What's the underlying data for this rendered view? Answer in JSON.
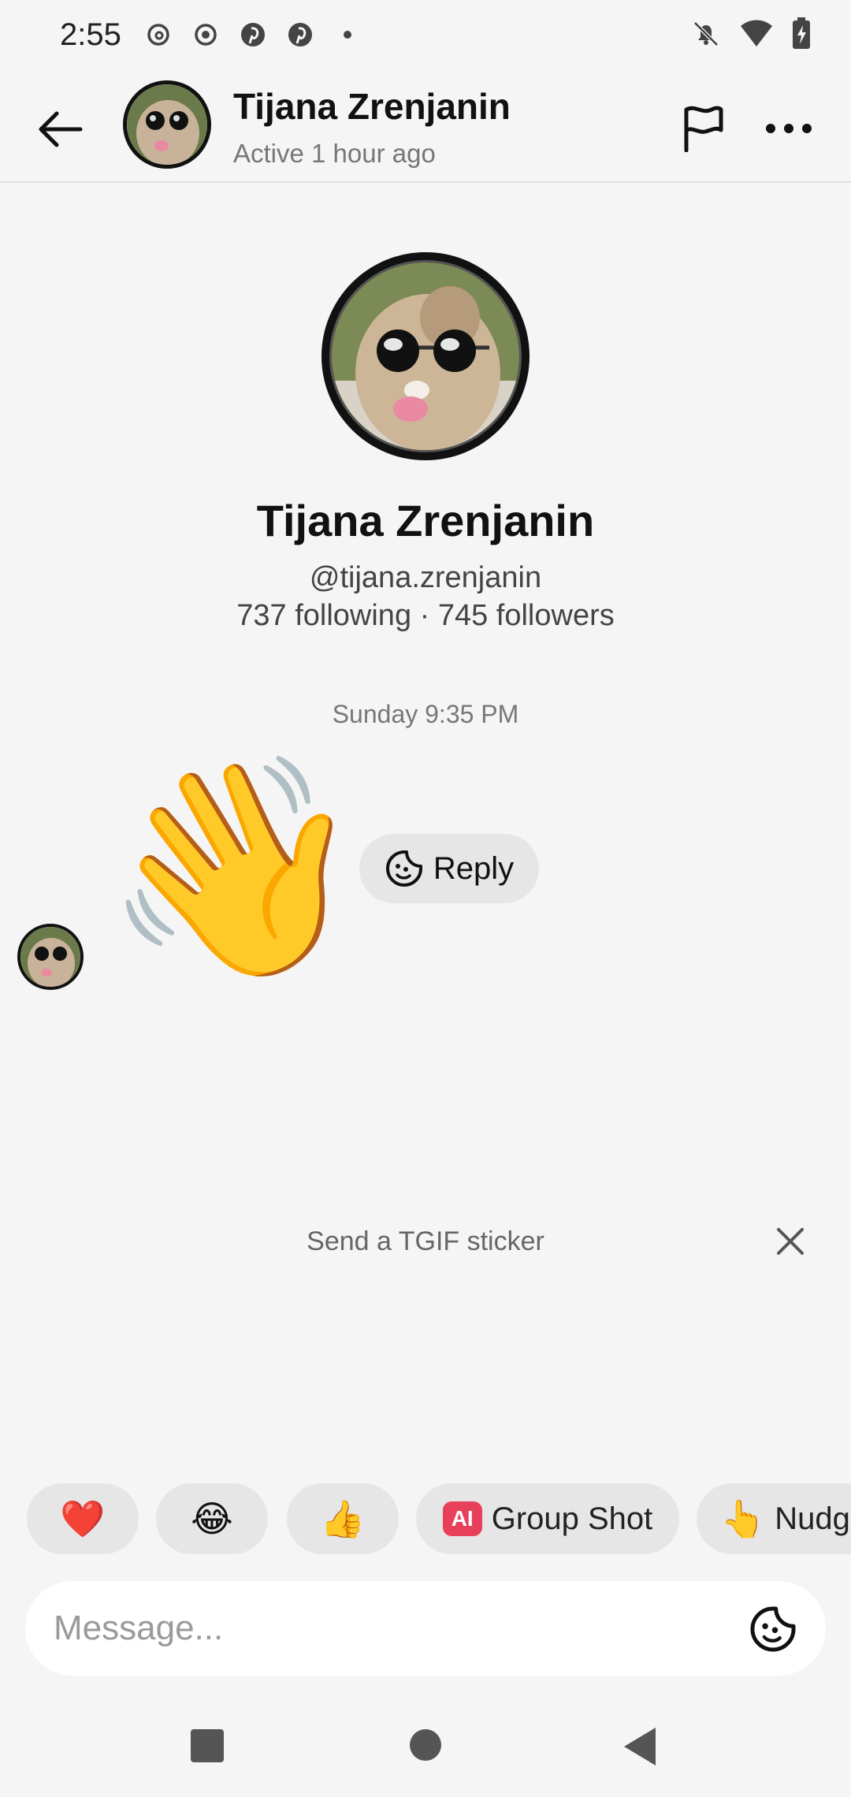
{
  "status_bar": {
    "time": "2:55",
    "left_icons": [
      "threads-icon",
      "record-icon",
      "pinterest-icon",
      "pinterest-icon",
      "dot-icon"
    ],
    "right_icons": [
      "bell-off-icon",
      "wifi-icon",
      "battery-charging-icon"
    ]
  },
  "header": {
    "name": "Tijana Zrenjanin",
    "status": "Active 1 hour ago"
  },
  "profile": {
    "name": "Tijana Zrenjanin",
    "handle": "@tijana.zrenjanin",
    "stats": "737 following · 745 followers"
  },
  "conversation": {
    "timestamp": "Sunday 9:35 PM",
    "sticker": "👋",
    "reply_label": "Reply"
  },
  "suggestion": {
    "text": "Send a TGIF sticker"
  },
  "quick_reactions": {
    "heart": "❤️",
    "laugh": "😂",
    "thumbs": "👍",
    "ai_badge": "AI",
    "group_shot": "Group Shot",
    "nudge_emoji": "👆",
    "nudge_label": "Nudge"
  },
  "composer": {
    "placeholder": "Message..."
  },
  "colors": {
    "background": "#f5f5f5",
    "chip": "#e6e6e6",
    "ai_badge": "#e8405a",
    "heart": "#e0202e"
  }
}
